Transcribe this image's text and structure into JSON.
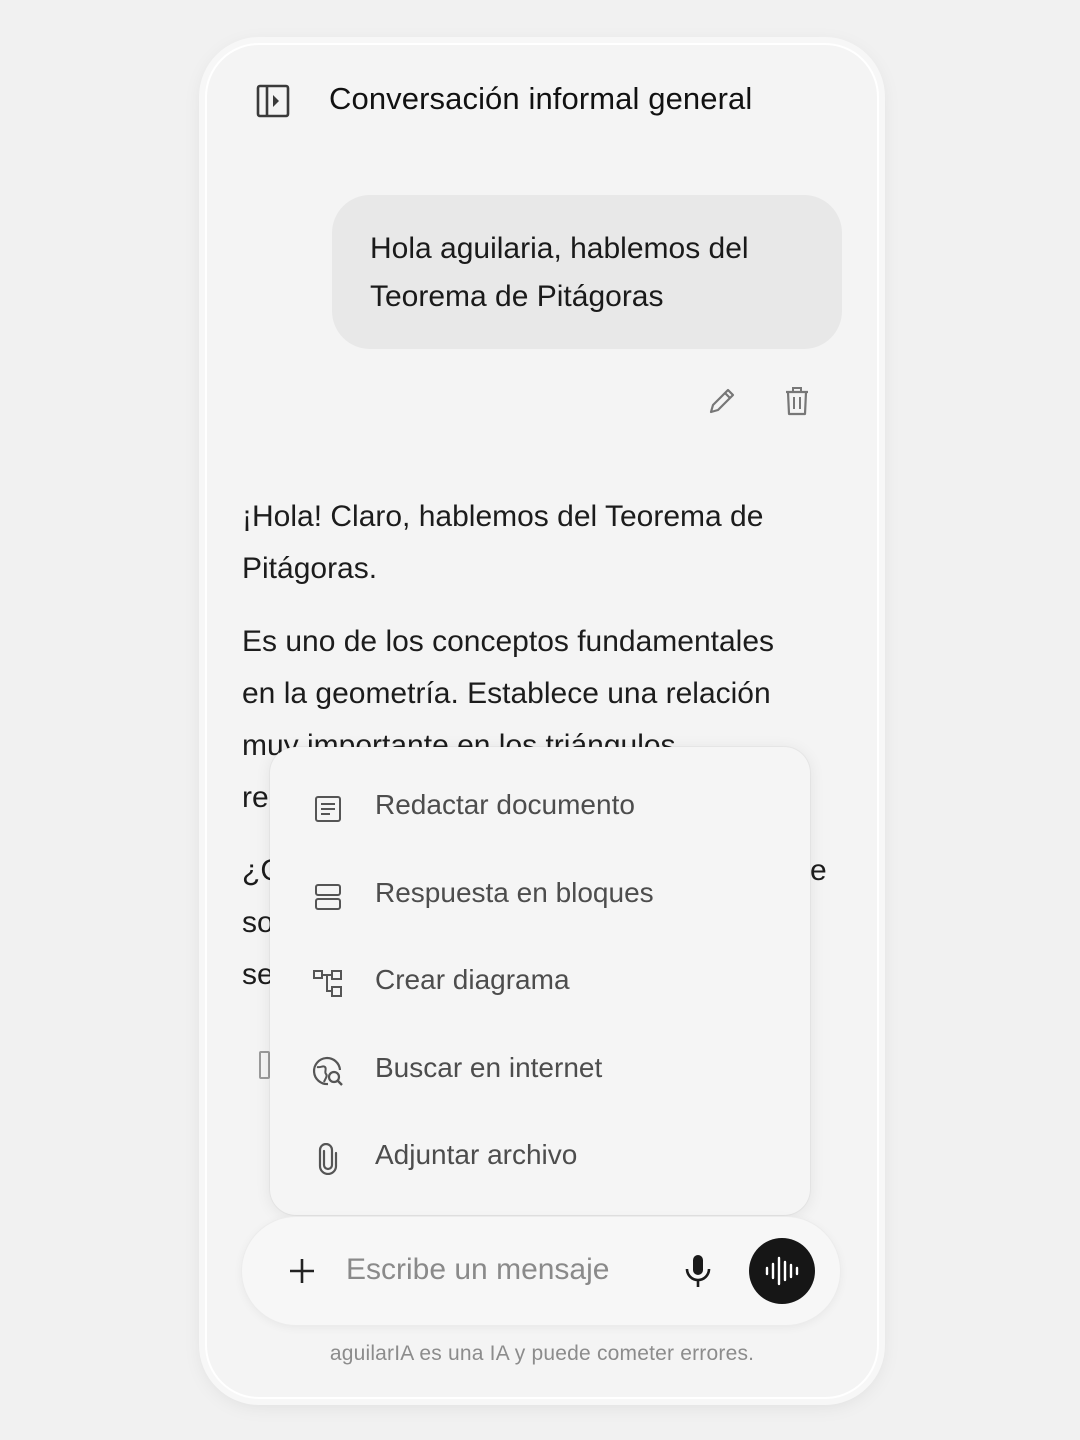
{
  "header": {
    "sidebar_icon": "sidebar-toggle-icon",
    "title": "Conversación informal general"
  },
  "user_message": {
    "lines": [
      "Hola aguilaria, hablemos del",
      "Teorema de Pitágoras"
    ],
    "actions": [
      {
        "icon": "pencil-icon",
        "label": "edit"
      },
      {
        "icon": "trash-icon",
        "label": "delete"
      }
    ]
  },
  "assistant_message": {
    "p1_lines": [
      "¡Hola! Claro, hablemos del Teorema de",
      "Pitágoras."
    ],
    "p2_lines": [
      "Es uno de los conceptos fundamentales",
      "en la geometría. Establece una relación",
      "muy importante en los triángulos",
      "re"
    ],
    "p3_lines": [
      "¿C",
      "so",
      "se"
    ],
    "p3_tail": "e"
  },
  "menu": {
    "items": [
      {
        "icon": "document-icon",
        "label": "Redactar documento"
      },
      {
        "icon": "blocks-icon",
        "label": "Respuesta en bloques"
      },
      {
        "icon": "diagram-icon",
        "label": "Crear diagrama"
      },
      {
        "icon": "web-search-icon",
        "label": "Buscar en internet"
      },
      {
        "icon": "paperclip-icon",
        "label": "Adjuntar archivo"
      }
    ]
  },
  "composer": {
    "plus_icon": "plus-icon",
    "placeholder": "Escribe un mensaje",
    "mic_icon": "microphone-icon",
    "voice_icon": "voice-waveform-icon"
  },
  "disclaimer": "aguilarIA es una IA y puede cometer errores.",
  "colors": {
    "background": "#f1f1f1",
    "panel": "#f4f4f4",
    "user_bubble": "#e8e8e8",
    "voice_button": "#161616",
    "menu_text": "#4d4d4d"
  }
}
